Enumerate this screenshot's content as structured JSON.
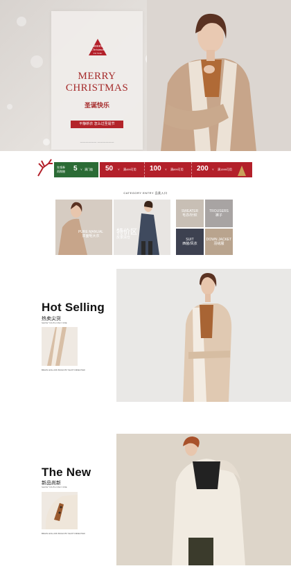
{
  "hero": {
    "badge_line1": "MERRY",
    "badge_line2": "Christmas",
    "badge_line3": "TO YOU",
    "title_line1": "MERRY",
    "title_line2": "CHRISTMAS",
    "subtitle": "圣诞快乐",
    "button": "平静新衣 怎么过圣诞节",
    "small_text": "一一一一一一 一一一一一一"
  },
  "coupon": {
    "label_line1": "先领券",
    "label_line2": "再购物",
    "items": [
      {
        "amount": "5",
        "unit": "Y",
        "cond": "满门槛"
      },
      {
        "amount": "50",
        "unit": "Y",
        "cond": "满499可用"
      },
      {
        "amount": "100",
        "unit": "Y",
        "cond": "满899可用"
      },
      {
        "amount": "200",
        "unit": "Y",
        "cond": "满1599可用"
      }
    ]
  },
  "category": {
    "title": "CATEGORY ENTRY 品类入口",
    "tile1": {
      "en": "PURE MANUAL",
      "cn": "双面呢大衣"
    },
    "tile2": {
      "cn": "特价区",
      "sub": "反季清仓"
    },
    "small": [
      {
        "en": "SWEATER",
        "cn": "毛衣/针织"
      },
      {
        "en": "TROUSERS",
        "cn": "裤子"
      },
      {
        "en": "SUIT",
        "cn": "西装/风衣"
      },
      {
        "en": "DOWN JACKET",
        "cn": "羽绒服"
      }
    ]
  },
  "hot": {
    "title": "Hot Selling",
    "cn": "热卖尖货",
    "en": "SHOW YOUTH ONLY ONE",
    "caption": "BRAIN HOLLOW BUILD BY SHOT DIRECTED"
  },
  "new": {
    "title": "The New",
    "cn": "新品尚新",
    "en": "SHOW YOUTH ONLY ONE",
    "caption": "BRAIN HOLLOW BUILD BY SHOT DIRECTED"
  },
  "colors": {
    "brand_red": "#b3202a",
    "brand_green": "#2b6b35",
    "coat_beige": "#c9a78a"
  }
}
